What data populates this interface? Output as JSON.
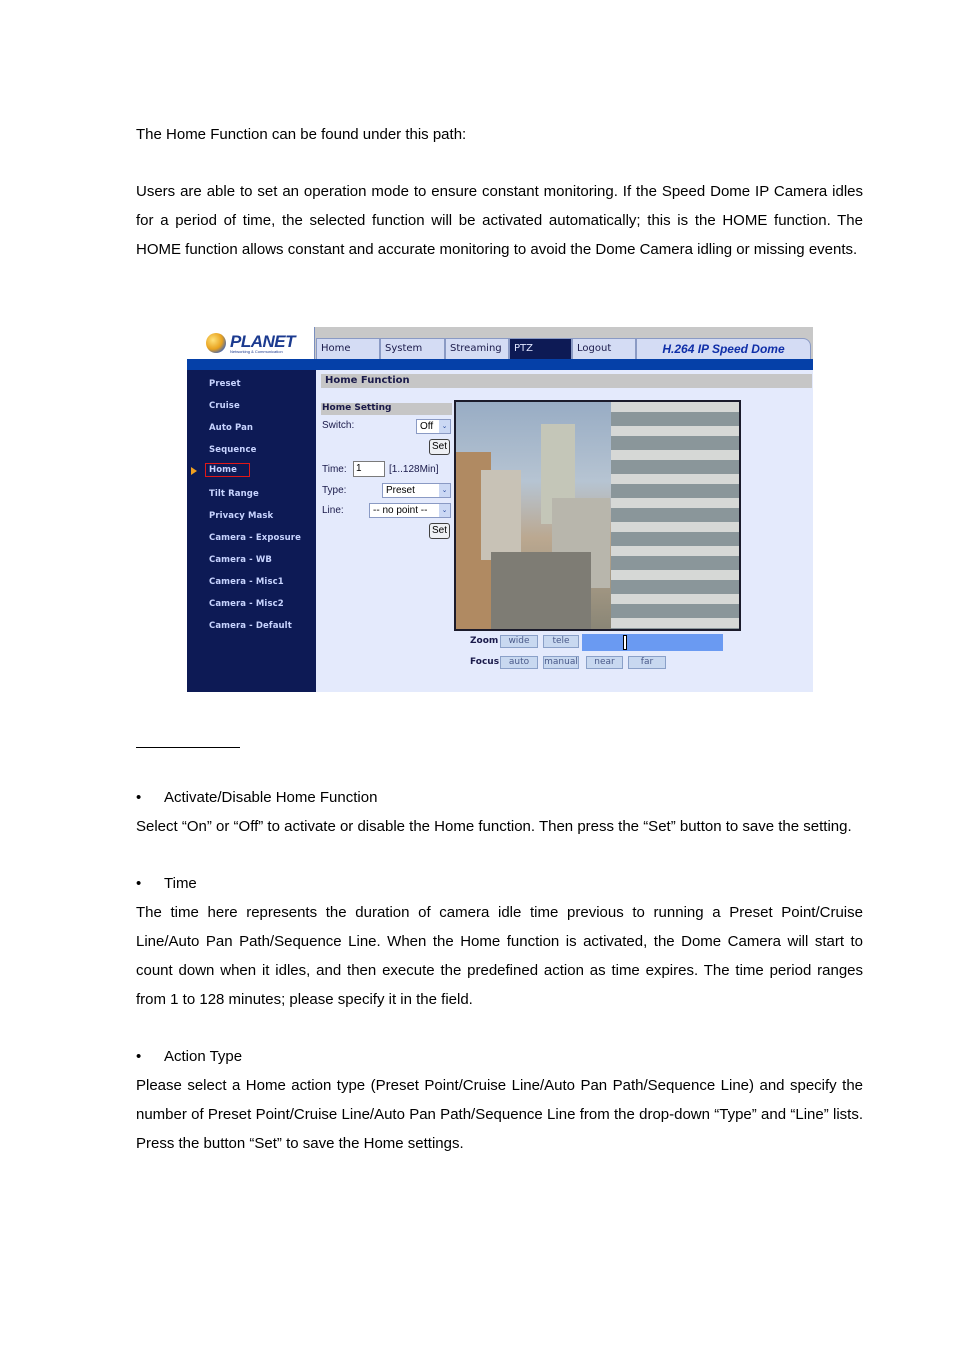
{
  "doc": {
    "intro": "The Home Function can be found under this path:",
    "description": "Users are able to set an operation mode to ensure constant monitoring. If the Speed Dome IP Camera idles for a period of time, the selected function will be activated automatically; this is the HOME function. The HOME function allows constant and accurate monitoring to avoid the Dome Camera idling or missing events.",
    "sections": [
      {
        "bullet": "Activate/Disable Home Function",
        "body": "Select “On” or “Off” to activate or disable the Home function. Then press the “Set” button to save the setting."
      },
      {
        "bullet": "Time",
        "body": "The time here represents the duration of camera idle time previous to running a Preset Point/Cruise Line/Auto Pan Path/Sequence Line. When the Home function is activated, the Dome Camera will start to count down when it idles, and then execute the predefined action as time expires. The time period ranges from 1 to 128 minutes; please specify it in the field."
      },
      {
        "bullet": "Action Type",
        "body": "Please select a Home action type (Preset Point/Cruise Line/Auto Pan Path/Sequence Line) and specify the number of Preset Point/Cruise Line/Auto Pan Path/Sequence Line from the drop-down “Type” and “Line” lists. Press the button “Set” to save the Home settings."
      }
    ],
    "bullet_glyph": "•"
  },
  "screenshot": {
    "logo": {
      "name": "PLANET",
      "tagline": "Networking & Communication"
    },
    "tabs": [
      {
        "label": "Home",
        "active": false
      },
      {
        "label": "System",
        "active": false
      },
      {
        "label": "Streaming",
        "active": false
      },
      {
        "label": "PTZ",
        "active": true
      },
      {
        "label": "Logout",
        "active": false
      }
    ],
    "brand": "H.264 IP Speed Dome",
    "sidebar": [
      {
        "label": "Preset"
      },
      {
        "label": "Cruise"
      },
      {
        "label": "Auto Pan"
      },
      {
        "label": "Sequence"
      },
      {
        "label": "Home",
        "active": true
      },
      {
        "label": "Tilt Range"
      },
      {
        "label": "Privacy Mask"
      },
      {
        "label": "Camera - Exposure"
      },
      {
        "label": "Camera - WB"
      },
      {
        "label": "Camera - Misc1"
      },
      {
        "label": "Camera - Misc2"
      },
      {
        "label": "Camera - Default"
      }
    ],
    "page_title": "Home Function",
    "setting": {
      "heading": "Home Setting",
      "switch_label": "Switch:",
      "switch_value": "Off",
      "set_label": "Set",
      "time_label": "Time:",
      "time_value": "1",
      "time_range": "[1..128Min]",
      "type_label": "Type:",
      "type_value": "Preset",
      "line_label": "Line:",
      "line_value": "-- no point --",
      "caret": "⌄"
    },
    "controls": {
      "zoom_label": "Zoom",
      "wide": "wide",
      "tele": "tele",
      "focus_label": "Focus",
      "auto": "auto",
      "manual": "manual",
      "near": "near",
      "far": "far",
      "zoom_level_fraction": 0.3
    },
    "colors": {
      "nav_dark": "#0d1a55",
      "nav_bar": "#0540a8",
      "content_bg": "#e4eafc",
      "active_outline": "#e01818",
      "zoom_track": "#6a9af2"
    }
  }
}
